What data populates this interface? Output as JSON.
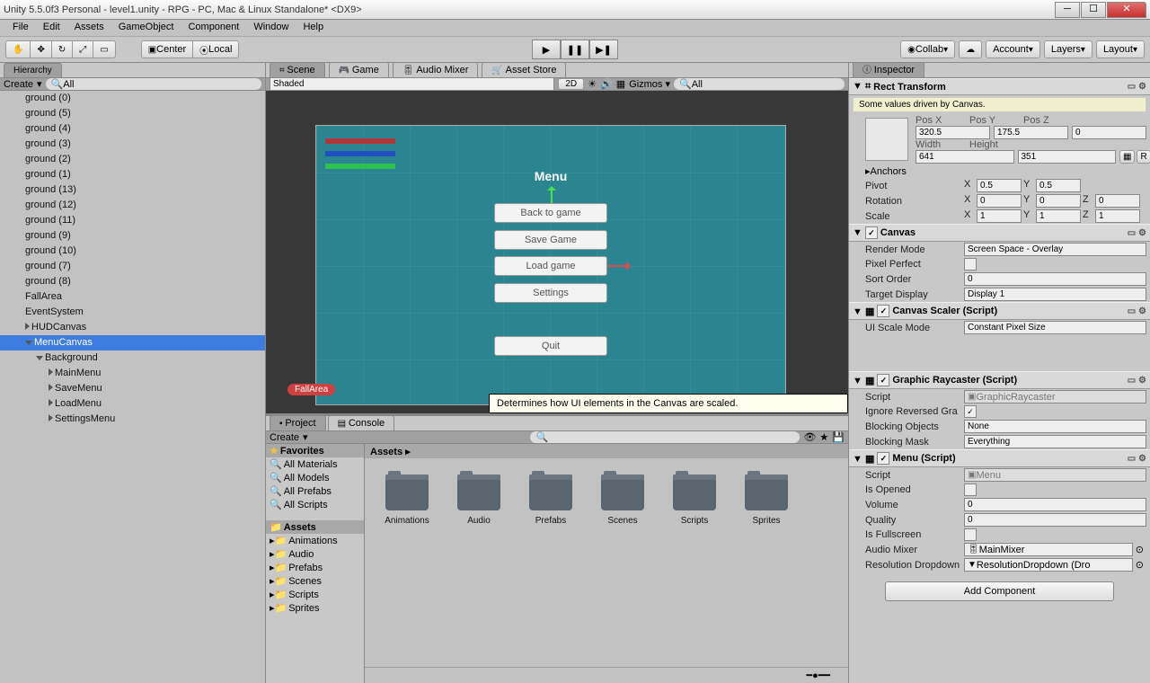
{
  "window": {
    "title": "Unity 5.5.0f3 Personal - level1.unity - RPG - PC, Mac & Linux Standalone* <DX9>"
  },
  "menubar": [
    "File",
    "Edit",
    "Assets",
    "GameObject",
    "Component",
    "Window",
    "Help"
  ],
  "toolbar": {
    "center": "Center",
    "local": "Local",
    "collab": "Collab",
    "account": "Account",
    "layers": "Layers",
    "layout": "Layout"
  },
  "hierarchy": {
    "tab": "Hierarchy",
    "create": "Create",
    "search_placeholder": "All",
    "items": [
      {
        "t": "ground (0)",
        "i": 0
      },
      {
        "t": "ground (5)",
        "i": 0
      },
      {
        "t": "ground (4)",
        "i": 0
      },
      {
        "t": "ground (3)",
        "i": 0
      },
      {
        "t": "ground (2)",
        "i": 0
      },
      {
        "t": "ground (1)",
        "i": 0
      },
      {
        "t": "ground (13)",
        "i": 0
      },
      {
        "t": "ground (12)",
        "i": 0
      },
      {
        "t": "ground (11)",
        "i": 0
      },
      {
        "t": "ground (9)",
        "i": 0
      },
      {
        "t": "ground (10)",
        "i": 0
      },
      {
        "t": "ground (7)",
        "i": 0
      },
      {
        "t": "ground (8)",
        "i": 0
      },
      {
        "t": "FallArea",
        "i": 0,
        "tri": false
      },
      {
        "t": "EventSystem",
        "i": 0,
        "tri": false
      },
      {
        "t": "HUDCanvas",
        "i": 0,
        "tri": "r"
      },
      {
        "t": "MenuCanvas",
        "i": 0,
        "tri": "d",
        "sel": true
      },
      {
        "t": "Background",
        "i": 1,
        "tri": "d"
      },
      {
        "t": "MainMenu",
        "i": 2,
        "tri": "r"
      },
      {
        "t": "SaveMenu",
        "i": 2,
        "tri": "r"
      },
      {
        "t": "LoadMenu",
        "i": 2,
        "tri": "r"
      },
      {
        "t": "SettingsMenu",
        "i": 2,
        "tri": "r"
      }
    ]
  },
  "scene": {
    "tabs": [
      "Scene",
      "Game",
      "Audio Mixer",
      "Asset Store"
    ],
    "shading": "Shaded",
    "mode2d": "2D",
    "gizmos": "Gizmos",
    "search_placeholder": "All",
    "menu_title": "Menu",
    "buttons": [
      "Back to game",
      "Save Game",
      "Load game",
      "Settings",
      "Quit"
    ],
    "fallarea": "FallArea",
    "tooltip": "Determines how UI elements in the Canvas are scaled."
  },
  "project": {
    "tabs": [
      "Project",
      "Console"
    ],
    "create": "Create",
    "favorites_hdr": "Favorites",
    "favorites": [
      "All Materials",
      "All Models",
      "All Prefabs",
      "All Scripts"
    ],
    "assets_hdr": "Assets",
    "tree": [
      "Animations",
      "Audio",
      "Prefabs",
      "Scenes",
      "Scripts",
      "Sprites"
    ],
    "crumb": "Assets ▸",
    "folders": [
      "Animations",
      "Audio",
      "Prefabs",
      "Scenes",
      "Scripts",
      "Sprites"
    ]
  },
  "inspector": {
    "tab": "Inspector",
    "rect": {
      "title": "Rect Transform",
      "msg": "Some values driven by Canvas.",
      "posx_l": "Pos X",
      "posy_l": "Pos Y",
      "posz_l": "Pos Z",
      "posx": "320.5",
      "posy": "175.5",
      "posz": "0",
      "w_l": "Width",
      "h_l": "Height",
      "w": "641",
      "h": "351",
      "anchors": "Anchors",
      "pivot": "Pivot",
      "px": "0.5",
      "py": "0.5",
      "rotation": "Rotation",
      "rx": "0",
      "ry": "0",
      "rz": "0",
      "scale": "Scale",
      "sx": "1",
      "sy": "1",
      "sz": "1"
    },
    "canvas": {
      "title": "Canvas",
      "render_l": "Render Mode",
      "render": "Screen Space - Overlay",
      "pixel_l": "Pixel Perfect",
      "sort_l": "Sort Order",
      "sort": "0",
      "target_l": "Target Display",
      "target": "Display 1"
    },
    "scaler": {
      "title": "Canvas Scaler (Script)",
      "mode_l": "UI Scale Mode",
      "mode": "Constant Pixel Size"
    },
    "raycaster": {
      "title": "Graphic Raycaster (Script)",
      "script_l": "Script",
      "script": "GraphicRaycaster",
      "ignore_l": "Ignore Reversed Gra",
      "blocking_l": "Blocking Objects",
      "blocking": "None",
      "mask_l": "Blocking Mask",
      "mask": "Everything"
    },
    "menu": {
      "title": "Menu (Script)",
      "script_l": "Script",
      "script": "Menu",
      "opened_l": "Is Opened",
      "vol_l": "Volume",
      "vol": "0",
      "qual_l": "Quality",
      "qual": "0",
      "fs_l": "Is Fullscreen",
      "mixer_l": "Audio Mixer",
      "mixer": "MainMixer",
      "res_l": "Resolution Dropdown",
      "res": "ResolutionDropdown (Dro"
    },
    "add": "Add Component"
  }
}
